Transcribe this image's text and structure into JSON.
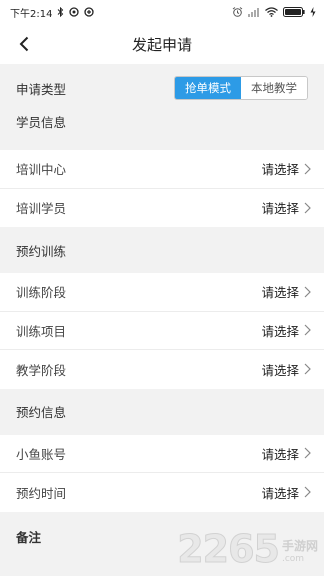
{
  "status_bar": {
    "time": "下午2:14"
  },
  "header": {
    "title": "发起申请"
  },
  "apply_type": {
    "label": "申请类型",
    "options": [
      "抢单模式",
      "本地教学"
    ],
    "selected": "抢单模式"
  },
  "sections": [
    {
      "title": "学员信息",
      "rows": [
        {
          "label": "培训中心",
          "value": "请选择"
        },
        {
          "label": "培训学员",
          "value": "请选择"
        }
      ]
    },
    {
      "title": "预约训练",
      "rows": [
        {
          "label": "训练阶段",
          "value": "请选择"
        },
        {
          "label": "训练项目",
          "value": "请选择"
        },
        {
          "label": "教学阶段",
          "value": "请选择"
        }
      ]
    },
    {
      "title": "预约信息",
      "rows": [
        {
          "label": "小鱼账号",
          "value": "请选择"
        },
        {
          "label": "预约时间",
          "value": "请选择"
        }
      ]
    },
    {
      "title": "备注",
      "rows": []
    }
  ],
  "watermark": {
    "number": "2265",
    "text": "手游网",
    "domain": ".com"
  },
  "colors": {
    "accent": "#2d9be6",
    "background": "#f2f2f2"
  }
}
